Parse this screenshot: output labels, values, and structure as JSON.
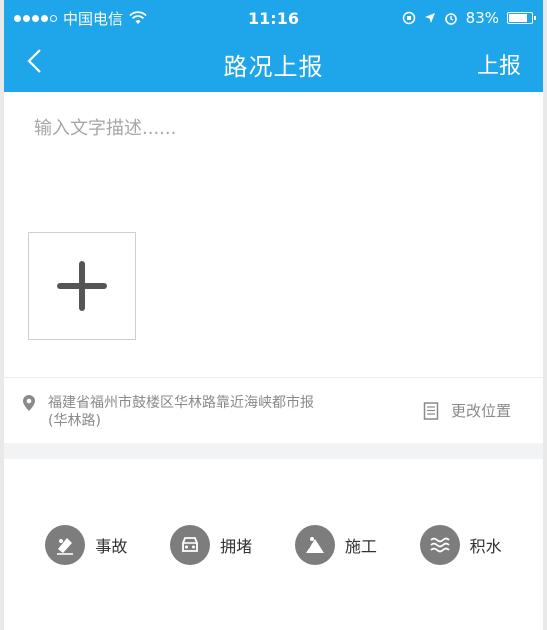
{
  "statusbar": {
    "carrier": "中国电信",
    "time": "11:16",
    "battery": "83%",
    "battery_level": 0.83
  },
  "navbar": {
    "back_symbol": "‹",
    "title": "路况上报",
    "action_label": "上报"
  },
  "input": {
    "placeholder": "输入文字描述......",
    "value": ""
  },
  "location": {
    "address": "福建省福州市鼓楼区华林路靠近海峡都市报(华林路)",
    "change_label": "更改位置"
  },
  "categories": [
    {
      "label": "事故",
      "icon": "accident-icon"
    },
    {
      "label": "拥堵",
      "icon": "congestion-icon"
    },
    {
      "label": "施工",
      "icon": "construction-icon"
    },
    {
      "label": "积水",
      "icon": "flooding-icon"
    }
  ]
}
